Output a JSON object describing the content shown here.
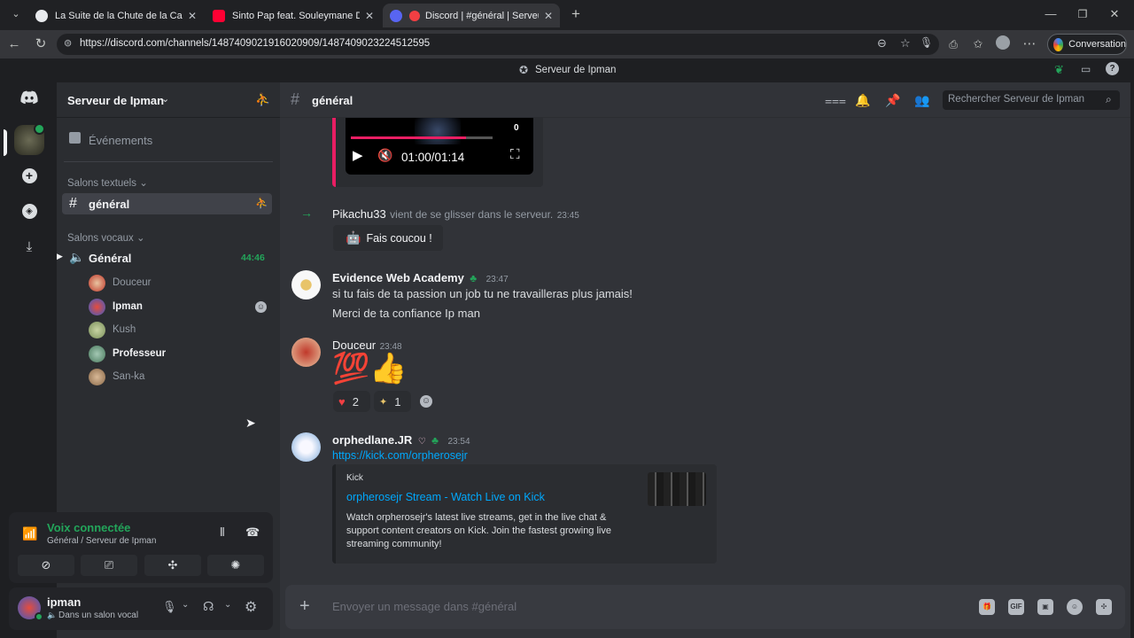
{
  "browser": {
    "tabs": [
      {
        "label": "La Suite de la Chute de la Cabale",
        "favicon_color": "#e8eaed"
      },
      {
        "label": "Sinto Pap feat. Souleymane Diama",
        "favicon_color": "#ff0033"
      },
      {
        "label": "Discord | #général | Serveur d",
        "favicon_color": "#5865f2"
      }
    ],
    "url": "https://discord.com/channels/1487409021916020909/1487409023224512595",
    "conversation_label": "Conversation"
  },
  "app": {
    "title": "Serveur de Ipman"
  },
  "sidebar": {
    "server_name": "Serveur de Ipman",
    "events_label": "Événements",
    "text_category": "Salons textuels",
    "text_channel": "général",
    "voice_category": "Salons vocaux",
    "voice_channel": "Général",
    "voice_timer": "44:46",
    "voice_users": [
      {
        "name": "Douceur",
        "color": "#c0392b"
      },
      {
        "name": "Ipman",
        "color": "#3a5bc7"
      },
      {
        "name": "Kush",
        "color": "#7a8f5a"
      },
      {
        "name": "Professeur",
        "color": "#4a7a5e"
      },
      {
        "name": "San-ka",
        "color": "#8a6a4a"
      }
    ]
  },
  "voice_panel": {
    "status": "Voix connectée",
    "location": "Général / Serveur de Ipman"
  },
  "user_panel": {
    "username": "ipman",
    "status": "Dans un salon vocal"
  },
  "channel_header": {
    "name": "général",
    "search_placeholder": "Rechercher Serveur de Ipman"
  },
  "video_player": {
    "time": "01:00/01:14",
    "counter": "0"
  },
  "messages": {
    "join": {
      "user": "Pikachu33",
      "text": "vient de se glisser dans le serveur.",
      "time": "23:45",
      "wave_label": "Fais coucou !"
    },
    "evidence": {
      "author": "Evidence Web Academy",
      "time": "23:47",
      "line1": "si tu fais de ta passion un job tu ne travailleras plus jamais!",
      "line2": "Merci de ta confiance Ip man"
    },
    "douceur": {
      "author": "Douceur",
      "time": "23:48",
      "emoji_100": "💯",
      "emoji_thumb": "👍",
      "reaction_heart_count": "2",
      "reaction_second_count": "1"
    },
    "orphe": {
      "author": "orphedlane.JR",
      "time": "23:54",
      "link": "https://kick.com/orpherosejr",
      "embed_provider": "Kick",
      "embed_title": "orpherosejr Stream - Watch Live on Kick",
      "embed_desc": "Watch orpherosejr's latest live streams, get in the live chat & support content creators on Kick. Join the fastest growing live streaming community!"
    }
  },
  "composer": {
    "placeholder": "Envoyer un message dans #général",
    "gif_label": "GIF"
  },
  "colors": {
    "accent": "#5865f2",
    "green": "#23a55a",
    "link": "#00a8fc"
  }
}
